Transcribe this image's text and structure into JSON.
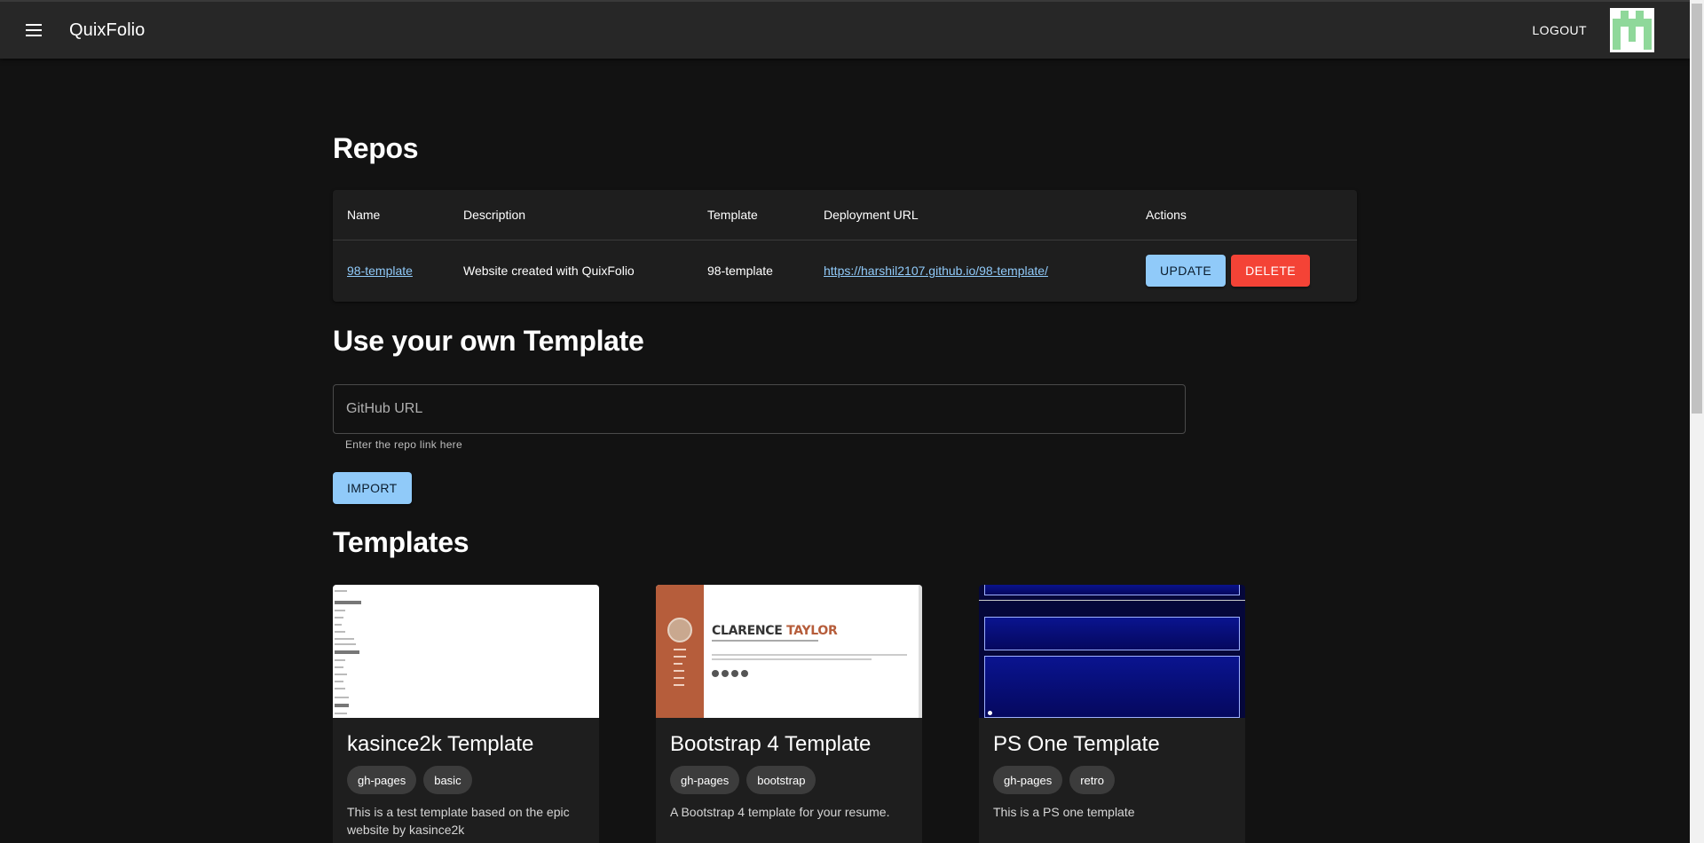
{
  "app": {
    "title": "QuixFolio",
    "menu_icon": "menu-icon",
    "logout_label": "LOGOUT",
    "avatar_icon": "identicon-avatar"
  },
  "repos": {
    "heading": "Repos",
    "columns": [
      "Name",
      "Description",
      "Template",
      "Deployment URL",
      "Actions"
    ],
    "rows": [
      {
        "name": "98-template",
        "description": "Website created with QuixFolio",
        "template": "98-template",
        "deployment_url": "https://harshil2107.github.io/98-template/",
        "update_label": "UPDATE",
        "delete_label": "DELETE"
      }
    ]
  },
  "own_template": {
    "heading": "Use your own Template",
    "input_placeholder": "GitHub URL",
    "input_value": "",
    "helper_text": "Enter the repo link here",
    "import_label": "IMPORT"
  },
  "templates": {
    "heading": "Templates",
    "cards": [
      {
        "title": "kasince2k Template",
        "tags": [
          "gh-pages",
          "basic"
        ],
        "description": "This is a test template based on the epic website by kasince2k"
      },
      {
        "title": "Bootstrap 4 Template",
        "tags": [
          "gh-pages",
          "bootstrap"
        ],
        "description": "A Bootstrap 4 template for your resume.",
        "preview_name_first": "CLARENCE",
        "preview_name_last": "TAYLOR"
      },
      {
        "title": "PS One Template",
        "tags": [
          "gh-pages",
          "retro"
        ],
        "description": "This is a PS one template"
      }
    ]
  },
  "colors": {
    "background": "#121212",
    "appbar": "#272727",
    "surface": "#1e1e1e",
    "primary": "#90caf9",
    "danger": "#f44336"
  }
}
